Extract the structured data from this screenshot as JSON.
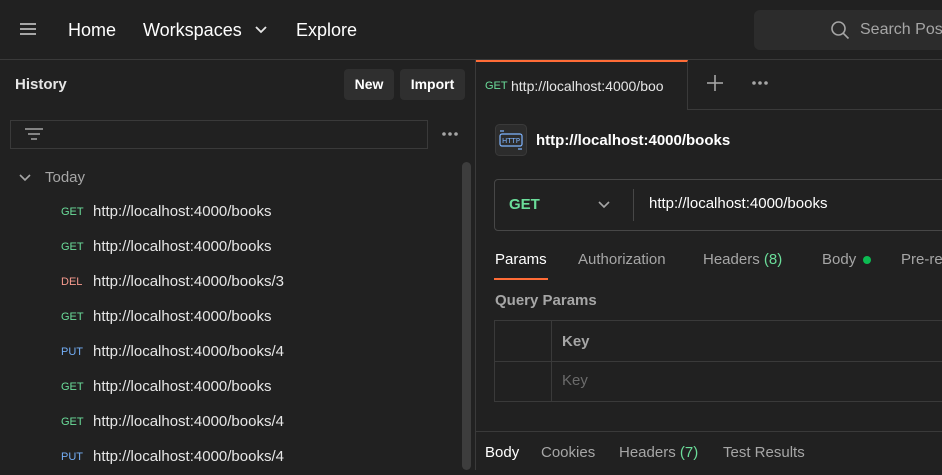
{
  "topbar": {
    "nav": [
      "Home",
      "Workspaces",
      "Explore"
    ],
    "search_placeholder": "Search Pos"
  },
  "sidebar": {
    "title": "History",
    "new_label": "New",
    "import_label": "Import",
    "group_label": "Today",
    "items": [
      {
        "method": "GET",
        "url": "http://localhost:4000/books"
      },
      {
        "method": "GET",
        "url": "http://localhost:4000/books"
      },
      {
        "method": "DEL",
        "url": "http://localhost:4000/books/3"
      },
      {
        "method": "GET",
        "url": "http://localhost:4000/books"
      },
      {
        "method": "PUT",
        "url": "http://localhost:4000/books/4"
      },
      {
        "method": "GET",
        "url": "http://localhost:4000/books"
      },
      {
        "method": "GET",
        "url": "http://localhost:4000/books/4"
      },
      {
        "method": "PUT",
        "url": "http://localhost:4000/books/4"
      }
    ]
  },
  "tabs": {
    "active": {
      "method": "GET",
      "url": "http://localhost:4000/boo"
    }
  },
  "request": {
    "title": "http://localhost:4000/books",
    "method": "GET",
    "url": "http://localhost:4000/books",
    "tabs": {
      "params": "Params",
      "authorization": "Authorization",
      "headers": "Headers",
      "headers_count": "(8)",
      "body": "Body",
      "prerequest": "Pre-re"
    },
    "query_params": {
      "title": "Query Params",
      "key_header": "Key",
      "key_placeholder": "Key"
    }
  },
  "response": {
    "tabs": {
      "body": "Body",
      "cookies": "Cookies",
      "headers": "Headers",
      "headers_count": "(7)",
      "test_results": "Test Results"
    }
  },
  "colors": {
    "accent": "#ff6c37",
    "get": "#6bdd9a",
    "delete": "#f79a8e",
    "put": "#74aef6",
    "body_dot": "#0cbb52"
  }
}
